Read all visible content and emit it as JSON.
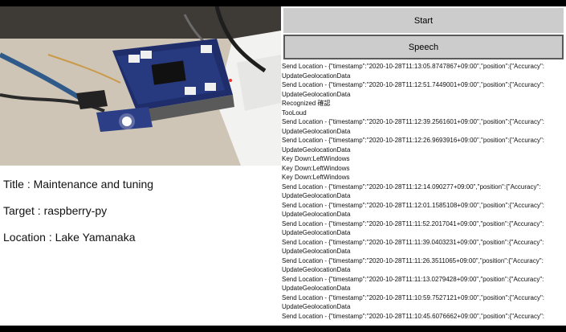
{
  "buttons": {
    "start_label": "Start",
    "speech_label": "Speech"
  },
  "info": {
    "title": "Title : Maintenance and tuning",
    "target": "Target : raspberry-py",
    "location": "Location : Lake Yamanaka"
  },
  "log": [
    "Send Location - {\"timestamp\":\"2020-10-28T11:13:05.8747867+09:00\",\"position\":{\"Accuracy\":",
    "UpdateGeolocationData",
    "Send Location - {\"timestamp\":\"2020-10-28T11:12:51.7449001+09:00\",\"position\":{\"Accuracy\":",
    "UpdateGeolocationData",
    "Recognized 確認",
    "TooLoud",
    "Send Location - {\"timestamp\":\"2020-10-28T11:12:39.2561601+09:00\",\"position\":{\"Accuracy\":",
    "UpdateGeolocationData",
    "Send Location - {\"timestamp\":\"2020-10-28T11:12:26.9693916+09:00\",\"position\":{\"Accuracy\":",
    "UpdateGeolocationData",
    "Key Down:LeftWindows",
    "Key Down:LeftWindows",
    "Key Down:LeftWindows",
    "Send Location - {\"timestamp\":\"2020-10-28T11:12:14.090277+09:00\",\"position\":{\"Accuracy\":",
    "UpdateGeolocationData",
    "Send Location - {\"timestamp\":\"2020-10-28T11:12:01.1585108+09:00\",\"position\":{\"Accuracy\":",
    "UpdateGeolocationData",
    "Send Location - {\"timestamp\":\"2020-10-28T11:11:52.2017041+09:00\",\"position\":{\"Accuracy\":",
    "UpdateGeolocationData",
    "Send Location - {\"timestamp\":\"2020-10-28T11:11:39.0403231+09:00\",\"position\":{\"Accuracy\":",
    "UpdateGeolocationData",
    "Send Location - {\"timestamp\":\"2020-10-28T11:11:26.3511065+09:00\",\"position\":{\"Accuracy\":",
    "UpdateGeolocationData",
    "Send Location - {\"timestamp\":\"2020-10-28T11:11:13.0279428+09:00\",\"position\":{\"Accuracy\":",
    "UpdateGeolocationData",
    "Send Location - {\"timestamp\":\"2020-10-28T11:10:59.7527121+09:00\",\"position\":{\"Accuracy\":",
    "UpdateGeolocationData",
    "Send Location - {\"timestamp\":\"2020-10-28T11:10:45.6076662+09:00\",\"position\":{\"Accuracy\":"
  ]
}
